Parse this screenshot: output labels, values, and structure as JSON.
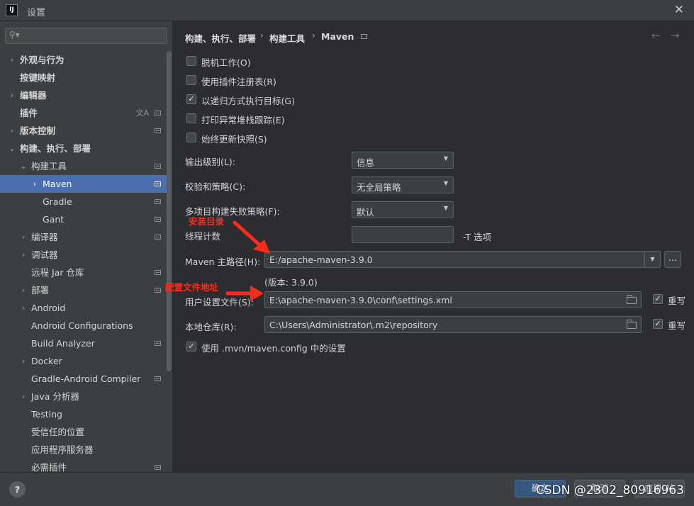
{
  "window": {
    "title": "设置",
    "app_icon": "IJ",
    "close_glyph": "✕"
  },
  "search": {
    "value": "",
    "placeholder": "",
    "icon": "search-icon"
  },
  "sidebar": {
    "items": [
      {
        "label": "外观与行为",
        "expandable": true,
        "expanded": false,
        "bold": true
      },
      {
        "label": "按键映射",
        "expandable": false,
        "bold": true
      },
      {
        "label": "编辑器",
        "expandable": true,
        "expanded": false,
        "bold": true
      },
      {
        "label": "插件",
        "expandable": false,
        "bold": true,
        "translate_icon": true,
        "project_icon": true
      },
      {
        "label": "版本控制",
        "expandable": true,
        "expanded": false,
        "bold": true,
        "project_icon": true
      },
      {
        "label": "构建、执行、部署",
        "expandable": true,
        "expanded": true,
        "bold": true
      },
      {
        "label": "构建工具",
        "expandable": true,
        "expanded": true,
        "project_icon": true
      },
      {
        "label": "Maven",
        "expandable": true,
        "expanded": false,
        "selected": true,
        "project_icon": true
      },
      {
        "label": "Gradle",
        "expandable": false,
        "project_icon": true
      },
      {
        "label": "Gant",
        "expandable": false,
        "project_icon": true
      },
      {
        "label": "编译器",
        "expandable": true,
        "expanded": false,
        "project_icon": true
      },
      {
        "label": "调试器",
        "expandable": true,
        "expanded": false
      },
      {
        "label": "远程 Jar 仓库",
        "expandable": false,
        "project_icon": true
      },
      {
        "label": "部署",
        "expandable": true,
        "expanded": false,
        "project_icon": true
      },
      {
        "label": "Android",
        "expandable": true,
        "expanded": false
      },
      {
        "label": "Android Configurations",
        "expandable": false
      },
      {
        "label": "Build Analyzer",
        "expandable": false,
        "project_icon": true
      },
      {
        "label": "Docker",
        "expandable": true,
        "expanded": false
      },
      {
        "label": "Gradle-Android Compiler",
        "expandable": false,
        "project_icon": true
      },
      {
        "label": "Java 分析器",
        "expandable": true,
        "expanded": false
      },
      {
        "label": "Testing",
        "expandable": false
      },
      {
        "label": "受信任的位置",
        "expandable": false
      },
      {
        "label": "应用程序服务器",
        "expandable": false
      },
      {
        "label": "必需插件",
        "expandable": false,
        "project_icon": true
      }
    ]
  },
  "breadcrumb": {
    "items": [
      "构建、执行、部署",
      "构建工具",
      "Maven"
    ],
    "separator": "›"
  },
  "nav": {
    "back": "←",
    "forward": "→"
  },
  "options": [
    {
      "label": "脱机工作(O)",
      "checked": false
    },
    {
      "label": "使用插件注册表(R)",
      "checked": false
    },
    {
      "label": "以递归方式执行目标(G)",
      "checked": true
    },
    {
      "label": "打印异常堆栈跟踪(E)",
      "checked": false
    },
    {
      "label": "始终更新快照(S)",
      "checked": false
    }
  ],
  "fields": {
    "output_level": {
      "label": "输出级别(L):",
      "value": "信息"
    },
    "checksum_policy": {
      "label": "校验和策略(C):",
      "value": "无全局策略"
    },
    "fail_policy": {
      "label": "多项目构建失败策略(F):",
      "value": "默认"
    },
    "thread_count": {
      "label": "线程计数",
      "value": "",
      "suffix": "-T 选项"
    },
    "maven_home": {
      "label": "Maven 主路径(H):",
      "value": "E:/apache-maven-3.9.0",
      "browse": "...",
      "version": "(版本: 3.9.0)"
    },
    "user_settings": {
      "label": "用户设置文件(S):",
      "value": "E:\\apache-maven-3.9.0\\conf\\settings.xml",
      "override_label": "重写",
      "override": true
    },
    "local_repo": {
      "label": "本地仓库(R):",
      "value": "C:\\Users\\Administrator\\.m2\\repository",
      "override_label": "重写",
      "override": true
    },
    "mvn_config": {
      "label": "使用 .mvn/maven.config 中的设置",
      "checked": true
    }
  },
  "annotations": {
    "install_dir": "安装目录",
    "config_file": "配置文件地址",
    "color": "#ff2a1a"
  },
  "footer": {
    "help": "?",
    "ok": "确定",
    "cancel": "取消",
    "apply": "应用(A)",
    "watermark": "CSDN @2302_80916963"
  },
  "colors": {
    "selection": "#4b6eaf",
    "panel": "#3c3f41",
    "content": "#2b2d30",
    "primary_button": "#365880"
  }
}
